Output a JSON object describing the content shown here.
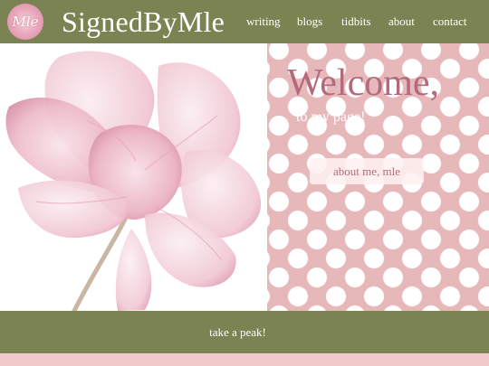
{
  "header": {
    "logo_text": "Mle",
    "site_title": "SignedByMle",
    "nav": [
      {
        "label": "writing"
      },
      {
        "label": "blogs"
      },
      {
        "label": "tidbits"
      },
      {
        "label": "about"
      },
      {
        "label": "contact"
      }
    ]
  },
  "hero": {
    "welcome_title": "Welcome,",
    "welcome_subtitle": "to my page!",
    "about_button_label": "about me, mle"
  },
  "bottom": {
    "link_label": "take a peak!"
  },
  "colors": {
    "olive": "#7b8352",
    "pink_background": "#e7b8b9",
    "accent_text": "#b36a7d",
    "white": "#ffffff"
  }
}
